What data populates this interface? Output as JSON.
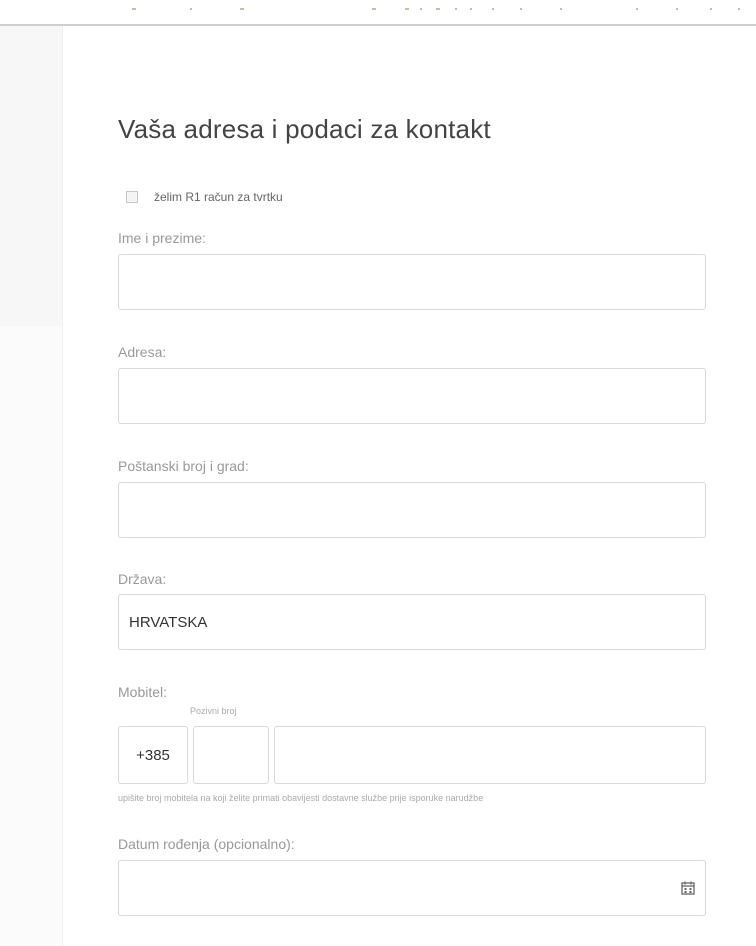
{
  "form": {
    "title": "Vaša adresa i podaci za kontakt",
    "r1_checkbox_label": "želim R1 račun za tvrtku",
    "full_name": {
      "label": "Ime i prezime:",
      "value": ""
    },
    "address": {
      "label": "Adresa:",
      "value": ""
    },
    "postal_city": {
      "label": "Poštanski broj i grad:",
      "value": ""
    },
    "country": {
      "label": "Država:",
      "value": "HRVATSKA"
    },
    "mobile": {
      "label": "Mobitel:",
      "prefix": "+385",
      "area_code_caption": "Pozivni broj",
      "area_code_value": "",
      "number_value": "",
      "hint": "upišite broj mobitela na koji želite primati obavijesti dostavne službe prije isporuke narudžbe"
    },
    "birth_date": {
      "label": "Datum rođenja (opcionalno):",
      "value": "",
      "icon": "calendar-icon"
    }
  }
}
